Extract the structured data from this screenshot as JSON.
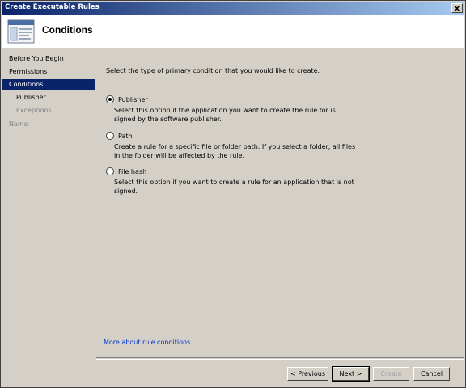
{
  "window": {
    "title": "Create Executable Rules",
    "close_icon": "close-icon"
  },
  "header": {
    "title": "Conditions",
    "icon": "wizard-page-icon"
  },
  "sidebar": {
    "items": [
      {
        "label": "Before You Begin",
        "state": "normal"
      },
      {
        "label": "Permissions",
        "state": "normal"
      },
      {
        "label": "Conditions",
        "state": "selected"
      },
      {
        "label": "Publisher",
        "state": "normal"
      },
      {
        "label": "Exceptions",
        "state": "disabled"
      },
      {
        "label": "Name",
        "state": "disabled"
      }
    ]
  },
  "content": {
    "intro": "Select the type of primary condition that you would like to create.",
    "options": [
      {
        "label": "Publisher",
        "description": "Select this option if the application you want to create the rule for is signed by the software publisher.",
        "checked": true
      },
      {
        "label": "Path",
        "description": "Create a rule for a specific file or folder path. If you select a folder, all files in the folder will be affected by the rule.",
        "checked": false
      },
      {
        "label": "File hash",
        "description": "Select this option if you want to create a rule for an application that is not signed.",
        "checked": false
      }
    ],
    "link": "More about rule conditions"
  },
  "buttons": {
    "previous": "< Previous",
    "next": "Next >",
    "create": "Create",
    "cancel": "Cancel"
  }
}
